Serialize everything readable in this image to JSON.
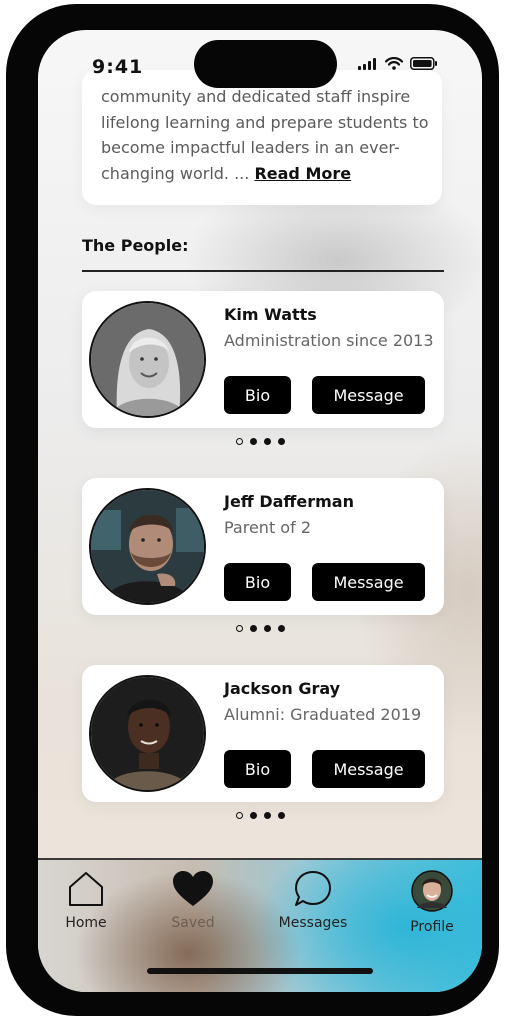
{
  "status_bar": {
    "time": "9:41"
  },
  "intro": {
    "text": "community and dedicated staff inspire lifelong learning and prepare students to become impactful leaders in an ever-changing world. ...",
    "read_more": "Read More"
  },
  "section": {
    "title": "The People:"
  },
  "people": [
    {
      "name": "Kim Watts",
      "role": "Administration since 2013",
      "bio_label": "Bio",
      "message_label": "Message"
    },
    {
      "name": "Jeff Dafferman",
      "role": "Parent of 2",
      "bio_label": "Bio",
      "message_label": "Message"
    },
    {
      "name": "Jackson Gray",
      "role": "Alumni: Graduated 2019",
      "bio_label": "Bio",
      "message_label": "Message"
    }
  ],
  "carousel": {
    "pages": 4,
    "active_index": 0
  },
  "tabbar": {
    "home": "Home",
    "saved": "Saved",
    "messages": "Messages",
    "profile": "Profile"
  },
  "icons": [
    "signal-icon",
    "wifi-icon",
    "battery-icon",
    "home-icon",
    "heart-icon",
    "chat-bubble-icon",
    "profile-avatar"
  ]
}
